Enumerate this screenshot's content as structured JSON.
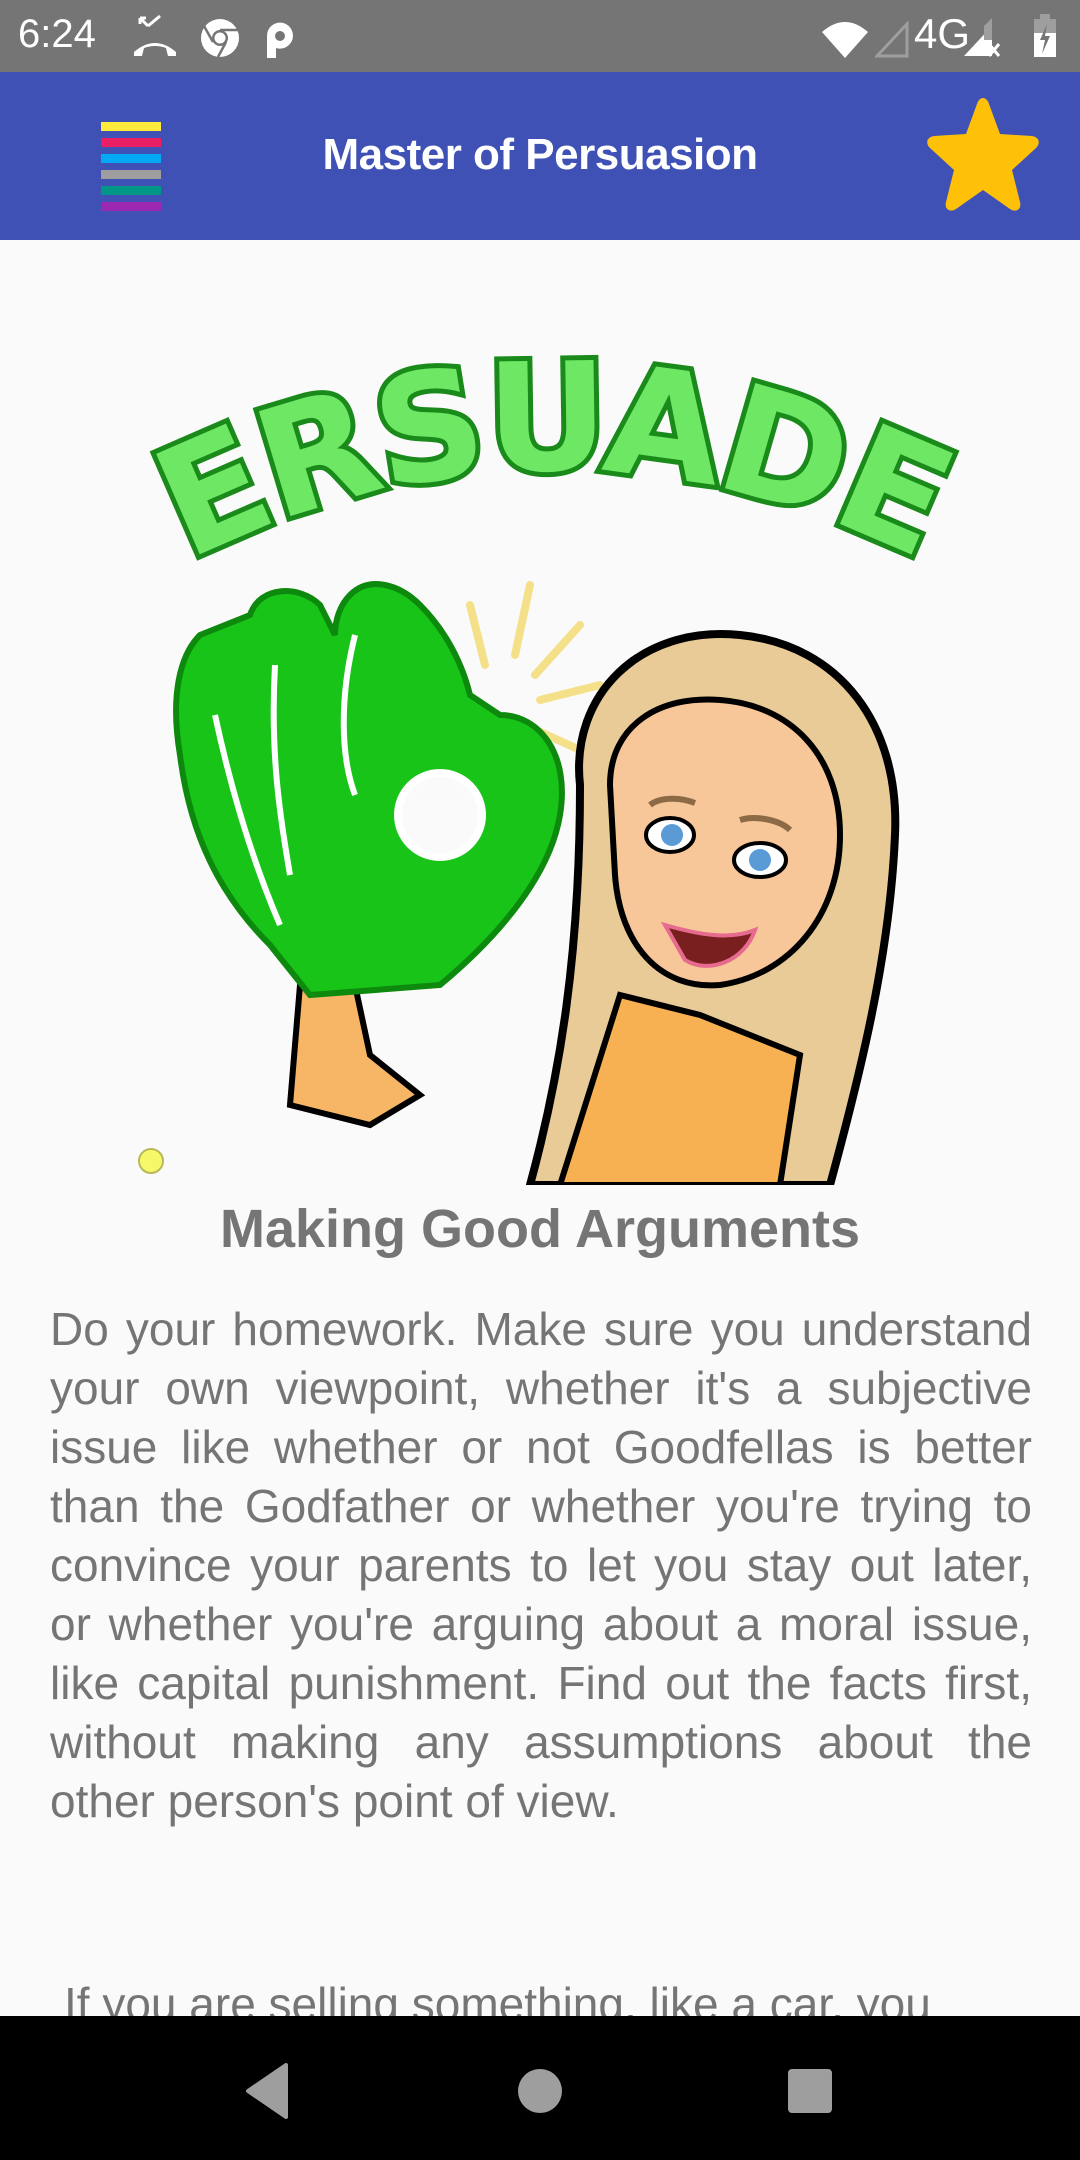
{
  "status_bar": {
    "time": "6:24",
    "left_icons": [
      "missed-call-icon",
      "chrome-icon",
      "parking-app-icon"
    ],
    "right_icons": [
      "wifi-icon",
      "signal-empty-icon",
      "4g-label",
      "signal-no-sim-icon",
      "battery-charging-icon"
    ],
    "network_label": "4G"
  },
  "app_bar": {
    "title": "Master of Persuasion",
    "menu_icon": "colorful-hamburger-menu-icon",
    "menu_colors": [
      "#ffeb3b",
      "#e91e63",
      "#03a9f4",
      "#9e9e9e",
      "#009688",
      "#9c27b0"
    ],
    "favorite_icon": "star-icon",
    "background_color": "#3f51b5",
    "star_color": "#ffc107"
  },
  "content": {
    "image": {
      "description": "Bitmoji sticker of a blonde woman holding a green foam OK-hand glove",
      "banner_text": "PERSUADER"
    },
    "section_title": "Making Good Arguments",
    "paragraphs": [
      "Do your homework. Make sure you understand your own viewpoint, whether it's a subjective issue like whether or not Goodfellas is better than the Godfather or whether you're trying to convince your parents to let you stay out later, or whether you're arguing about a moral issue, like capital punishment. Find out the facts first, without making any assumptions about the other person's point of view.",
      "If you are selling something, like a car, you"
    ],
    "text_color": "#757575"
  },
  "nav_bar": {
    "buttons": [
      "back",
      "home",
      "recents"
    ]
  }
}
